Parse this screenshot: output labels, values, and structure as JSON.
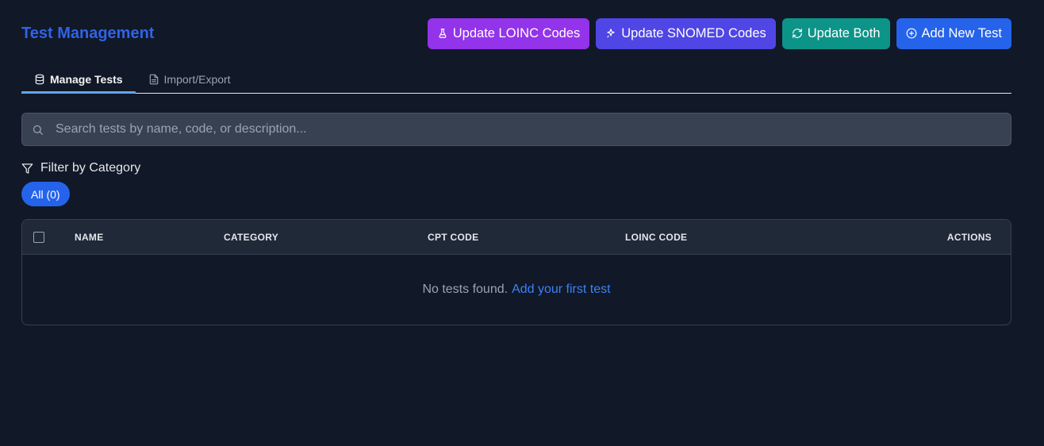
{
  "header": {
    "title": "Test Management",
    "buttons": {
      "loinc": "Update LOINC Codes",
      "snomed": "Update SNOMED Codes",
      "both": "Update Both",
      "add": "Add New Test"
    }
  },
  "tabs": [
    {
      "label": "Manage Tests",
      "active": true,
      "icon": "database-icon"
    },
    {
      "label": "Import/Export",
      "active": false,
      "icon": "file-text-icon"
    }
  ],
  "search": {
    "value": "",
    "placeholder": "Search tests by name, code, or description..."
  },
  "filter": {
    "label": "Filter by Category",
    "chips": [
      {
        "label": "All (0)",
        "active": true
      }
    ]
  },
  "table": {
    "columns": [
      "NAME",
      "CATEGORY",
      "CPT CODE",
      "LOINC CODE",
      "ACTIONS"
    ],
    "rows": [],
    "empty_text": "No tests found.",
    "empty_link": "Add your first test"
  },
  "colors": {
    "background": "#111827",
    "title": "#2f63e8",
    "loinc_button": "#9333ea",
    "snomed_button": "#4f46e5",
    "both_button": "#0d9488",
    "add_button": "#2563eb",
    "link": "#3b82f6"
  }
}
